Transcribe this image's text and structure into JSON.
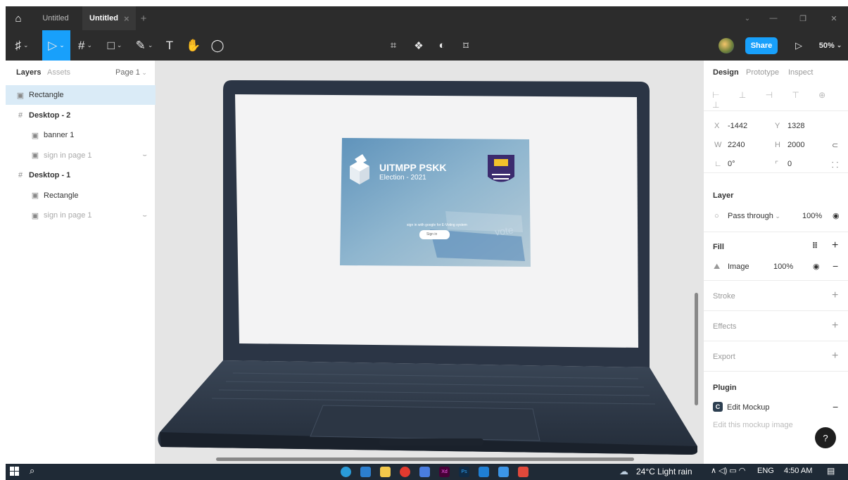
{
  "titlebar": {
    "tabs": [
      {
        "label": "Untitled"
      },
      {
        "label": "Untitled"
      }
    ],
    "new_tab": "+",
    "window_controls": {
      "minimize": "—",
      "restore": "❐",
      "close": "✕"
    }
  },
  "toolbar": {
    "share_label": "Share",
    "zoom": "50%"
  },
  "left_panel": {
    "tabs": {
      "layers": "Layers",
      "assets": "Assets"
    },
    "page": "Page 1",
    "layers": [
      {
        "name": "Rectangle",
        "type": "image",
        "level": 0,
        "selected": true
      },
      {
        "name": "Desktop - 2",
        "type": "frame",
        "level": 0
      },
      {
        "name": "banner 1",
        "type": "image",
        "level": 1
      },
      {
        "name": "sign in page 1",
        "type": "image",
        "level": 1,
        "muted": true
      },
      {
        "name": "Desktop - 1",
        "type": "frame",
        "level": 0
      },
      {
        "name": "Rectangle",
        "type": "image",
        "level": 1
      },
      {
        "name": "sign in page 1",
        "type": "image",
        "level": 1,
        "muted": true
      }
    ]
  },
  "mockup": {
    "title": "UITMPP PSKK",
    "subtitle": "Election - 2021",
    "signin_text": "sign in with google for E-Voting system",
    "signin_button": "Sign in",
    "vote_text": "vote"
  },
  "right_panel": {
    "tabs": {
      "design": "Design",
      "prototype": "Prototype",
      "inspect": "Inspect"
    },
    "x": {
      "label": "X",
      "value": "-1442"
    },
    "y": {
      "label": "Y",
      "value": "1328"
    },
    "w": {
      "label": "W",
      "value": "2240"
    },
    "h": {
      "label": "H",
      "value": "2000"
    },
    "rotation": {
      "value": "0°"
    },
    "radius": {
      "value": "0"
    },
    "layer": {
      "title": "Layer",
      "blend": "Pass through",
      "opacity": "100%"
    },
    "fill": {
      "title": "Fill",
      "type": "Image",
      "opacity": "100%"
    },
    "stroke": "Stroke",
    "effects": "Effects",
    "export": "Export",
    "plugin": {
      "title": "Plugin",
      "name": "Edit Mockup",
      "desc": "Edit this mockup image"
    },
    "help": "?"
  },
  "taskbar": {
    "weather": "24°C  Light rain",
    "lang": "ENG",
    "time": "4:50 AM"
  }
}
